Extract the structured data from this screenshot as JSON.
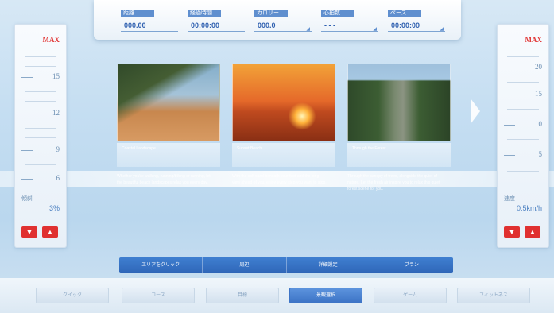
{
  "header": {
    "stats": [
      {
        "label": "距離",
        "value": "000.00"
      },
      {
        "label": "経過時間",
        "value": "00:00:00"
      },
      {
        "label": "カロリー",
        "value": "000.0"
      },
      {
        "label": "心拍数",
        "value": "- - -"
      },
      {
        "label": "ペース",
        "value": "00:00:00"
      }
    ]
  },
  "left_panel": {
    "max_label": "MAX",
    "ticks": [
      "15",
      "12",
      "9",
      "6"
    ],
    "current_label": "傾斜",
    "current_value": "3%",
    "down_label": "▼",
    "up_label": "▲"
  },
  "right_panel": {
    "max_label": "MAX",
    "ticks": [
      "20",
      "15",
      "10",
      "5"
    ],
    "current_label": "速度",
    "current_value": "0.5km/h",
    "down_label": "▼",
    "up_label": "▲"
  },
  "courses": [
    {
      "caption": "Coastal Landscape",
      "description": "Whether you're walking, running/biking or running, let the beautiful beach landscapes relax you every day.",
      "photo": "beach"
    },
    {
      "caption": "Sunset Beach",
      "description": "With the soft sand beneath your feet and the long view ahead of you, enjoy every step you want to stop.",
      "photo": "sunset"
    },
    {
      "caption": "Through the Forest",
      "description": "Through the canopy of trees, alongside the quiet of nature. Let the fresh air inspire you to relax this quiet forest scene for you.",
      "photo": "road"
    }
  ],
  "tabs": [
    "エリアをクリック",
    "周辺",
    "詳細設定",
    "プラン"
  ],
  "bottom_buttons": [
    "クイック",
    "コース",
    "目標",
    "景観選択",
    "ゲーム",
    "フィットネス"
  ],
  "active_bottom_index": 3,
  "icons": {
    "next": "chevron-right-icon"
  }
}
